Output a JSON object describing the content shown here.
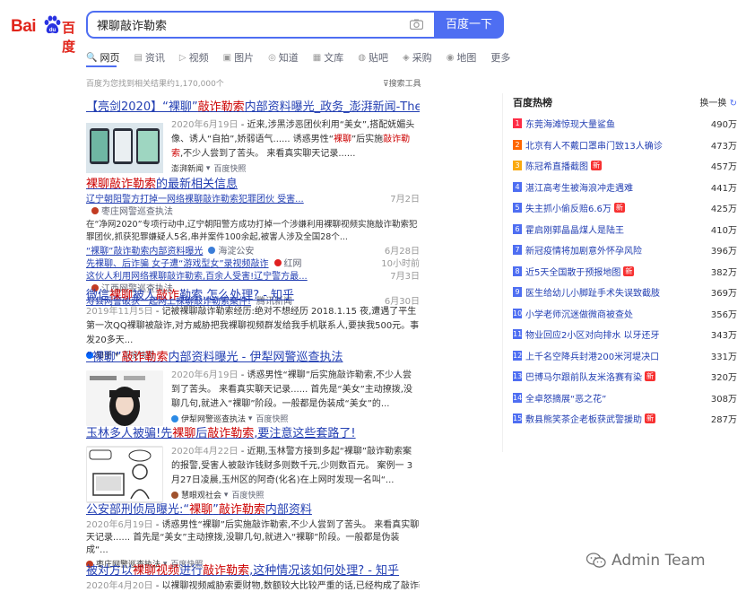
{
  "logo": {
    "bai": "Bai",
    "du": "百度"
  },
  "search": {
    "value": "裸聊敲诈勒索",
    "button": "百度一下"
  },
  "tabs": [
    {
      "icon": "🔍",
      "label": "网页"
    },
    {
      "icon": "▤",
      "label": "资讯"
    },
    {
      "icon": "▷",
      "label": "视频"
    },
    {
      "icon": "▣",
      "label": "图片"
    },
    {
      "icon": "◎",
      "label": "知道"
    },
    {
      "icon": "▦",
      "label": "文库"
    },
    {
      "icon": "◍",
      "label": "贴吧"
    },
    {
      "icon": "◈",
      "label": "采购"
    },
    {
      "icon": "◉",
      "label": "地图"
    },
    {
      "icon": "",
      "label": "更多"
    }
  ],
  "result_meta": "百度为您找到相关结果约1,170,000个",
  "search_tools": "搜索工具",
  "results": {
    "r1": {
      "title_pre": "【亮剑2020】“裸聊”",
      "title_red": "敲诈勒索",
      "title_post": "内部资料曝光_政务_澎湃新闻-The...",
      "date": "2020年6月19日",
      "snippet1": " - 近来,涉黑涉恶团伙利用“美女”,搭配妩媚头像、诱人“自拍”,娇弱语气...... 诱惑男性“",
      "snippet_red": "裸聊",
      "snippet2": "”后实施",
      "snippet_red2": "敲诈勒索",
      "snippet3": ",不少人尝到了苦头。 来看真实聊天记录......",
      "source": "澎湃新闻",
      "cache": "百度快照"
    },
    "news": {
      "title_red": "裸聊敲诈勒索",
      "title_post": "的最新相关信息",
      "items": [
        {
          "title": "辽宁朝阳警方打掉一网络裸聊敲诈勒索犯罪团伙 受害...",
          "source": "枣庄网警巡查执法",
          "date": "7月2日"
        },
        {
          "title": "“裸聊”敲诈勒索内部资料曝光",
          "source": "海淀公安",
          "date": "6月28日"
        },
        {
          "title": "先裸聊、后诈骗 女子遭“游戏型女”录视频敲诈",
          "source": "红网",
          "date": "10小时前"
        },
        {
          "title": "这伙人利用网络裸聊敲诈勒索,百余人受害!辽宁警方最...",
          "source": "江西网警巡查执法",
          "date": "7月3日"
        },
        {
          "title": "寿县网警破获一起网上裸聊敲诈勒索案件!",
          "source": "腾讯新闻",
          "date": "6月30日"
        }
      ],
      "snippet": "在“净网2020”专项行动中,辽宁朝阳警方成功打掉一个涉嫌利用裸聊视频实施敲诈勒索犯罪团伙,抓获犯罪嫌疑人5名,串并案件100余起,被害人涉及全国28个..."
    },
    "r3": {
      "title_pre": "微信",
      "title_red": "裸聊",
      "title_mid": "被人",
      "title_red2": "敲诈",
      "title_post": "勒索,怎么处理? - 知乎",
      "date": "2019年11月5日",
      "snippet": " - 记被裸聊敲诈勒索经历:绝对不想经历 2018.1.15 夜,遭遇了平生第一次QQ裸聊被敲诈,对方威胁把我裸聊视频群发给我手机联系人,要挟我500元。事发20多天...",
      "source": "知乎",
      "cache": "百度快照"
    },
    "r4": {
      "title_pre": "“裸聊”",
      "title_red": "敲诈勒索",
      "title_post": "内部资料曝光 - 伊犁网警巡查执法",
      "date": "2020年6月19日",
      "snippet": " - 诱惑男性“裸聊”后实施敲诈勒索,不少人尝到了苦头。 来看真实聊天记录...... 首先是“美女”主动撩拨,没聊几句,就进入“裸聊”阶段。一般都是伪装成“美女”的...",
      "source": "伊犁网警巡查执法",
      "cache": "百度快照"
    },
    "r5": {
      "title_pre": "玉林多人被骗!先",
      "title_red": "裸聊",
      "title_mid": "后",
      "title_red2": "敲诈勒索",
      "title_post": ",要注意这些套路了!",
      "date": "2020年4月22日",
      "snippet": " - 近期,玉林警方接到多起“裸聊”敲诈勒索案的报警,受害人被敲诈钱财多则数千元,少则数百元。 案例一 3月27日凌晨,玉州区的阿奇(化名)在上网时发现一名叫“...",
      "source": "慧眼观社会",
      "cache": "百度快照"
    },
    "r6": {
      "title_pre": "公安部刑侦局曝光:“",
      "title_red": "裸聊",
      "title_mid": "”",
      "title_red2": "敲诈勒索",
      "title_post": "内部资料",
      "date": "2020年6月19日",
      "snippet": " - 诱惑男性“裸聊”后实施敲诈勒索,不少人尝到了苦头。 来看真实聊天记录...... 首先是“美女”主动撩拨,没聊几句,就进入“裸聊”阶段。一般都是伪装成“...",
      "source": "枣庄网警巡查执法",
      "cache": "百度快照"
    },
    "r7": {
      "title_pre": "被对方以",
      "title_red": "裸聊视频",
      "title_mid": "进行",
      "title_red2": "敲诈勒索",
      "title_post": ",这种情况该如何处理? - 知乎",
      "date": "2020年4月20日",
      "snippet": " - 以裸聊视频威胁索要财物,数额较大比较严重的话,已经构成了敲诈勒索罪,是"
    }
  },
  "hot": {
    "title": "百度热榜",
    "refresh": "换一换",
    "items": [
      {
        "rank": "1",
        "text": "东莞海滩惊现大量鲨鱼",
        "num": "490万",
        "badge": ""
      },
      {
        "rank": "2",
        "text": "北京有人不戴口罩串门致13人确诊",
        "num": "473万",
        "badge": ""
      },
      {
        "rank": "3",
        "text": "陈冠希直播截图",
        "num": "457万",
        "badge": "新"
      },
      {
        "rank": "4",
        "text": "湛江高考生被海浪冲走遇难",
        "num": "441万",
        "badge": ""
      },
      {
        "rank": "5",
        "text": "失主抓小偷反赔6.6万",
        "num": "425万",
        "badge": "新"
      },
      {
        "rank": "6",
        "text": "霍启刚郭晶晶煤人是陆王",
        "num": "410万",
        "badge": ""
      },
      {
        "rank": "7",
        "text": "新冠疫情将加剧意外怀孕风险",
        "num": "396万",
        "badge": ""
      },
      {
        "rank": "8",
        "text": "近5天全国散于预报地图",
        "num": "382万",
        "badge": "新"
      },
      {
        "rank": "9",
        "text": "医生给幼儿小脚趾手术失误致截肢",
        "num": "369万",
        "badge": ""
      },
      {
        "rank": "10",
        "text": "小学老师沉迷做微商被查处",
        "num": "356万",
        "badge": ""
      },
      {
        "rank": "11",
        "text": "物业回应2小区对向排水 以牙还牙",
        "num": "343万",
        "badge": ""
      },
      {
        "rank": "12",
        "text": "上千名空降兵封港200米河堤决口",
        "num": "331万",
        "badge": ""
      },
      {
        "rank": "13",
        "text": "巴博马尔跟前队友米洛赛有染",
        "num": "320万",
        "badge": "新"
      },
      {
        "rank": "14",
        "text": "全卓怒摘展“恶之花”",
        "num": "308万",
        "badge": ""
      },
      {
        "rank": "15",
        "text": "敷县熊笑茶企老板获武警援助",
        "num": "287万",
        "badge": "新"
      }
    ]
  },
  "watermark": "Admin Team",
  "colors": {
    "accent": "#4e6ef2",
    "link": "#2440b3",
    "highlight": "#c00",
    "rank_top1": "#fe2d46",
    "rank_top2": "#f60",
    "rank_top3": "#faa90e",
    "rank_other": "#4e6ef2"
  }
}
